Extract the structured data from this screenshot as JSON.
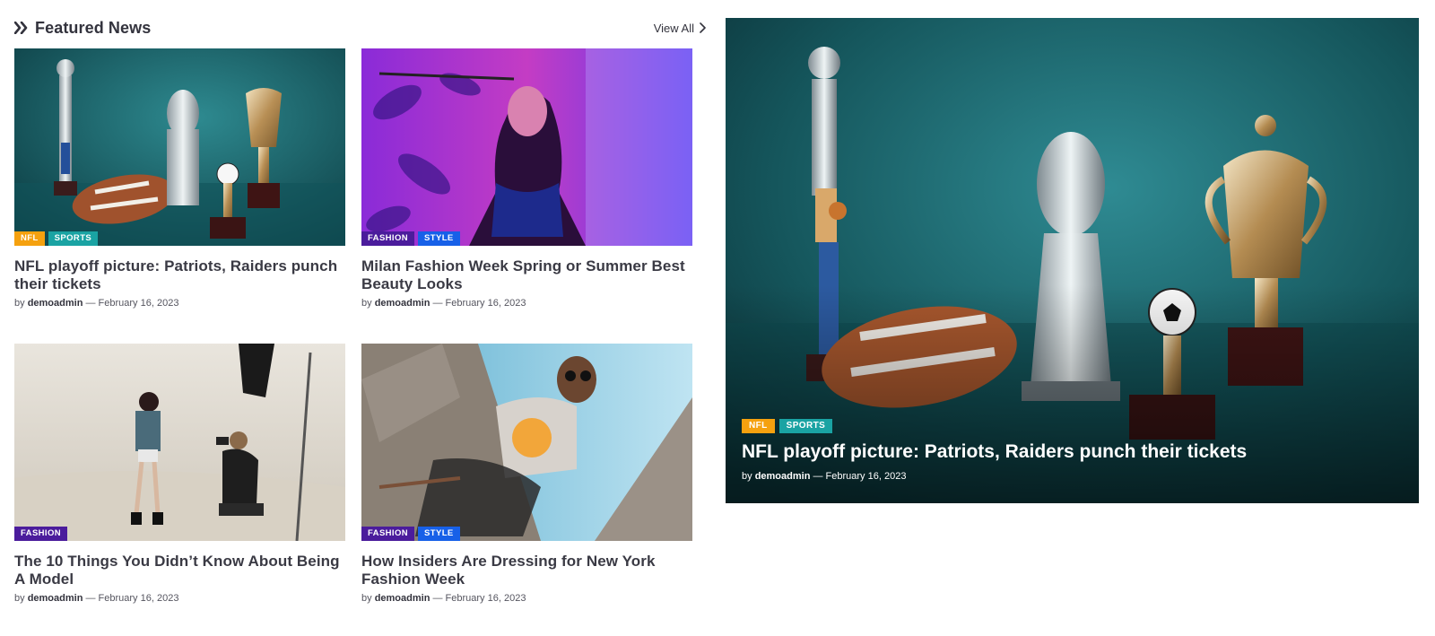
{
  "section": {
    "title": "Featured News",
    "title_icon": "double-chevron-right-icon",
    "view_all": "View All",
    "view_all_icon": "chevron-right-icon"
  },
  "colors": {
    "nfl": "#f5a10f",
    "sports": "#1aa3a3",
    "fashion": "#4b1c9c",
    "style": "#1760e8"
  },
  "cards": [
    {
      "tags": [
        "NFL",
        "SPORTS"
      ],
      "title": "NFL playoff picture: Patriots, Raiders punch their tickets",
      "by": "by",
      "author": "demoadmin",
      "date": "— February 16, 2023",
      "image": "trophies-and-football-on-teal-background"
    },
    {
      "tags": [
        "FASHION",
        "STYLE"
      ],
      "title": "Milan Fashion Week Spring or Summer Best Beauty Looks",
      "by": "by",
      "author": "demoadmin",
      "date": "— February 16, 2023",
      "image": "woman-in-neon-purple-light"
    },
    {
      "tags": [
        "FASHION"
      ],
      "title": "The 10 Things You Didn’t Know About Being A Model",
      "by": "by",
      "author": "demoadmin",
      "date": "— February 16, 2023",
      "image": "photographer-shooting-model-in-studio"
    },
    {
      "tags": [
        "FASHION",
        "STYLE"
      ],
      "title": "How Insiders Are Dressing for New York Fashion Week",
      "by": "by",
      "author": "demoadmin",
      "date": "— February 16, 2023",
      "image": "woman-with-sunglasses-on-concrete-wall"
    }
  ],
  "hero": {
    "tags": [
      "NFL",
      "SPORTS"
    ],
    "title": "NFL playoff picture: Patriots, Raiders punch their tickets",
    "by": "by",
    "author": "demoadmin",
    "date": "— February 16, 2023",
    "image": "trophies-and-football-on-teal-background"
  }
}
